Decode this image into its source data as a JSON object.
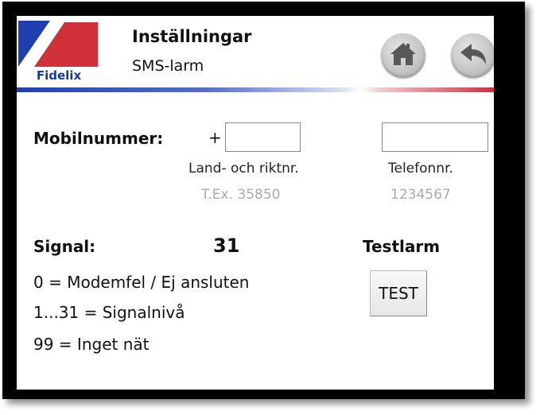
{
  "header": {
    "logo_text": "Fidelix",
    "title": "Inställningar",
    "subtitle": "SMS-larm",
    "home_icon": "home-icon",
    "back_icon": "back-arrow-icon"
  },
  "colors": {
    "brand_blue": "#1e3fb0",
    "brand_red": "#d0303a",
    "button_grey": "#c6c6c6"
  },
  "form": {
    "mobile_label": "Mobilnummer:",
    "plus_sign": "+",
    "country_code_value": "",
    "phone_value": "",
    "country_code_label": "Land- och riktnr.",
    "phone_label": "Telefonnr.",
    "country_code_hint": "T.Ex. 35850",
    "phone_hint": "1234567"
  },
  "signal": {
    "label": "Signal:",
    "value": "31",
    "legend": [
      "0 = Modemfel / Ej ansluten",
      "1...31 = Signalnivå",
      "99 = Inget nät"
    ]
  },
  "testlarm": {
    "label": "Testlarm",
    "button_label": "TEST"
  }
}
